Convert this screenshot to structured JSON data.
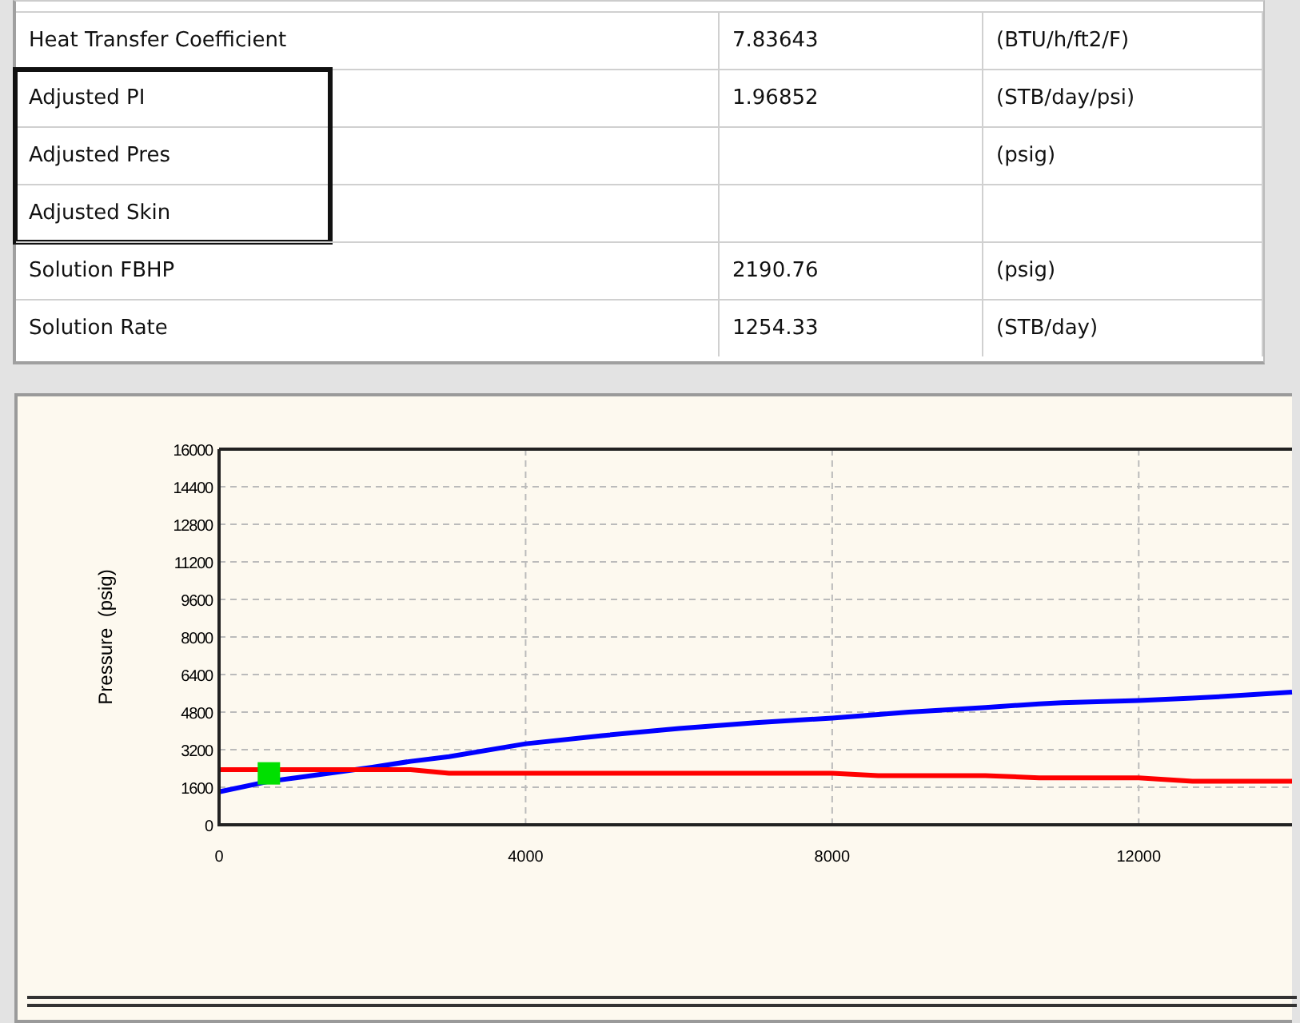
{
  "table": {
    "rows": [
      {
        "label": "Heat Transfer Coefficient",
        "value": "7.83643",
        "unit": "(BTU/h/ft2/F)",
        "highlighted": false
      },
      {
        "label": "Adjusted PI",
        "value": "1.96852",
        "unit": "(STB/day/psi)",
        "highlighted": true
      },
      {
        "label": "Adjusted Pres",
        "unit": "(psig)",
        "highlighted": true
      },
      {
        "label": "Adjusted Skin",
        "highlighted": true
      },
      {
        "label": "Solution FBHP",
        "value": "2190.76",
        "unit": "(psig)",
        "highlighted": false
      },
      {
        "label": "Solution Rate",
        "value": "1254.33",
        "unit": "(STB/day)",
        "highlighted": false
      }
    ]
  },
  "chart": {
    "chart_data": {
      "type": "line",
      "ylabel": "Pressure  (psig)",
      "x": [
        0,
        650,
        1000,
        2000,
        2500,
        3000,
        4000,
        5000,
        6000,
        7000,
        8000,
        8600,
        9000,
        10000,
        10700,
        11000,
        12000,
        12700,
        13000,
        14000
      ],
      "series": [
        {
          "color": "#0000ff",
          "values": [
            1400,
            1850,
            2000,
            2450,
            2700,
            2900,
            3450,
            3800,
            4100,
            4350,
            4550,
            4700,
            4800,
            5000,
            5150,
            5200,
            5300,
            5400,
            5450,
            5650
          ]
        },
        {
          "color": "#ff0000",
          "values": [
            2350,
            null,
            2350,
            2350,
            2350,
            2200,
            2200,
            2200,
            2200,
            2200,
            2200,
            2100,
            2100,
            2100,
            2000,
            2000,
            2000,
            1850,
            1850,
            1850
          ]
        },
        {
          "color": "#00e000",
          "type": "scatter",
          "values": [
            null,
            2190,
            null,
            null,
            null,
            null,
            null,
            null,
            null,
            null,
            null,
            null,
            null,
            null,
            null,
            null,
            null,
            null,
            null,
            null
          ]
        }
      ],
      "grid": true,
      "xlim": [
        0,
        14000
      ],
      "ylim": [
        0,
        16000
      ],
      "xticks": [
        0,
        4000,
        8000,
        12000
      ],
      "yticks": [
        0,
        1600,
        3200,
        4800,
        6400,
        8000,
        9600,
        11200,
        12800,
        14400,
        16000
      ]
    }
  }
}
